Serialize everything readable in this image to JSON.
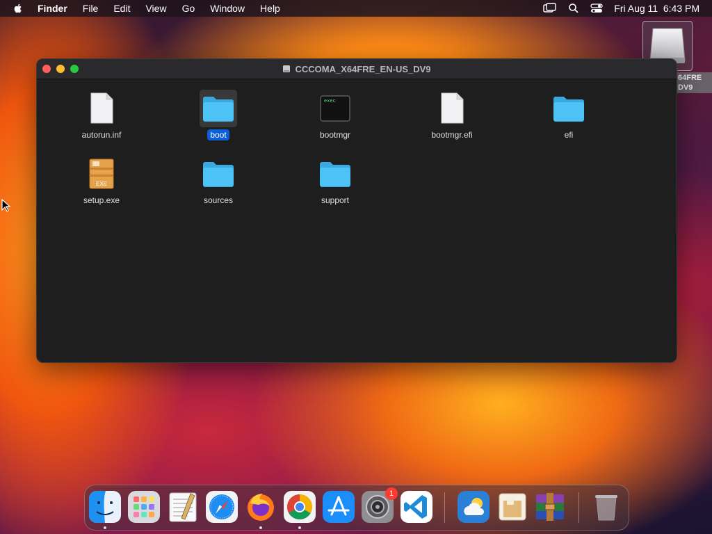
{
  "menubar": {
    "app_name": "Finder",
    "menus": [
      "File",
      "Edit",
      "View",
      "Go",
      "Window",
      "Help"
    ],
    "clock": "Fri Aug 11  6:43 PM"
  },
  "desktop": {
    "volume_label_line1": "64FRE",
    "volume_label_line2": "DV9"
  },
  "window": {
    "title": "CCCOMA_X64FRE_EN-US_DV9",
    "items": [
      {
        "name": "autorun.inf",
        "kind": "document",
        "selected": false
      },
      {
        "name": "boot",
        "kind": "folder",
        "selected": true
      },
      {
        "name": "bootmgr",
        "kind": "exec",
        "selected": false
      },
      {
        "name": "bootmgr.efi",
        "kind": "document",
        "selected": false
      },
      {
        "name": "efi",
        "kind": "folder",
        "selected": false
      },
      {
        "name": "setup.exe",
        "kind": "exe",
        "selected": false
      },
      {
        "name": "sources",
        "kind": "folder",
        "selected": false
      },
      {
        "name": "support",
        "kind": "folder",
        "selected": false
      }
    ],
    "exec_icon_text": "exec",
    "exe_icon_text": "EXE"
  },
  "dock": {
    "apps": [
      "finder-icon",
      "launchpad-icon",
      "textedit-icon",
      "safari-icon",
      "firefox-icon",
      "chrome-icon",
      "app-store-icon",
      "system-settings-icon",
      "vscode-icon",
      "weather-icon",
      "archive-utility-icon",
      "winrar-icon",
      "trash-icon"
    ],
    "settings_badge": "1"
  },
  "colors": {
    "selection": "#0a5fd8",
    "folder": "#4cc2f5",
    "window_bg": "#1e1e1e"
  }
}
